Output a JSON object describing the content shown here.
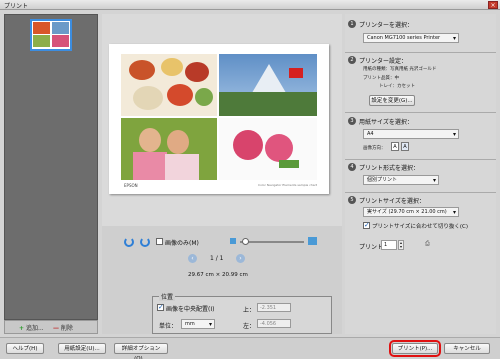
{
  "window": {
    "title": "プリント",
    "close_label": "×"
  },
  "left_panel": {
    "add_label": "追加...",
    "remove_label": "削除"
  },
  "preview": {
    "brand": "EPSON",
    "footer_text": "Color Navigator Elements sample chart",
    "image_only_label": "画像のみ(M)",
    "page_indicator": "1 / 1",
    "paper_size_text": "29.67 cm × 20.99 cm"
  },
  "position": {
    "legend": "位置",
    "center_label": "画像を中央配置(I)",
    "center_checked": true,
    "unit_label": "単位：",
    "unit_value": "mm",
    "top_label": "上：",
    "top_value": "-2.351",
    "left_label": "左：",
    "left_value": "-4.056"
  },
  "steps": [
    {
      "num": "1",
      "label": "プリンターを選択：",
      "select": "Canon MG7100 series Printer"
    },
    {
      "num": "2",
      "label": "プリンター設定：",
      "paper_type": "用紙の種類：写真用紙 光沢ゴールド",
      "quality": "プリント品質：中",
      "tray": "トレイ：カセット",
      "button": "設定を変更(G)..."
    },
    {
      "num": "3",
      "label": "用紙サイズを選択：",
      "select": "A4",
      "orientation_label": "画像方向："
    },
    {
      "num": "4",
      "label": "プリント形式を選択：",
      "select": "個別プリント"
    },
    {
      "num": "5",
      "label": "プリントサイズを選択：",
      "select": "実サイズ (29.70 cm × 21.00 cm)",
      "fit_label": "プリントサイズに合わせて切り抜く(C)",
      "fit_checked": true
    }
  ],
  "copies": {
    "label": "プリント",
    "value": "1"
  },
  "bottom_buttons": {
    "help": "ヘルプ(H)",
    "page_setup": "用紙設定(U)...",
    "more_options": "詳細オプション(O)...",
    "print": "プリント(P)...",
    "cancel": "キャンセル"
  },
  "colors": {
    "accent": "#2f7fd6",
    "highlight": "#e01010"
  }
}
